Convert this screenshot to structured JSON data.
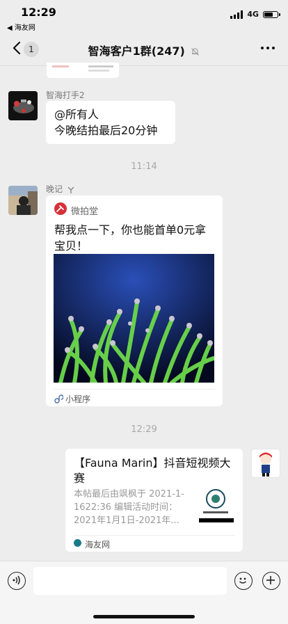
{
  "status_bar": {
    "time": "12:29",
    "back_app": "◀ 海友网",
    "network": "4G"
  },
  "nav": {
    "back_count": "1",
    "title": "智海客户1群(247)"
  },
  "messages": [
    {
      "sender": "智海打手2",
      "lines": [
        "@所有人",
        "今晚结拍最后20分钟"
      ]
    },
    {
      "timestamp": "11:14"
    },
    {
      "sender": "晚记",
      "card": {
        "app_name": "微拍堂",
        "text": "帮我点一下，你也能首单0元拿宝贝！",
        "footer": "小程序"
      }
    },
    {
      "timestamp": "12:29"
    },
    {
      "link_card": {
        "title": "【Fauna Marin】抖音短视频大赛",
        "desc": "本帖最后由飒枫于 2021-1-1622:36 编辑活动时间：2021年1月1日-2021年...",
        "source": "海友网"
      }
    }
  ],
  "colors": {
    "background": "#ededed",
    "bubble": "#ffffff",
    "timestamp": "#a8a8a8",
    "nickname": "#7a7a7a"
  }
}
